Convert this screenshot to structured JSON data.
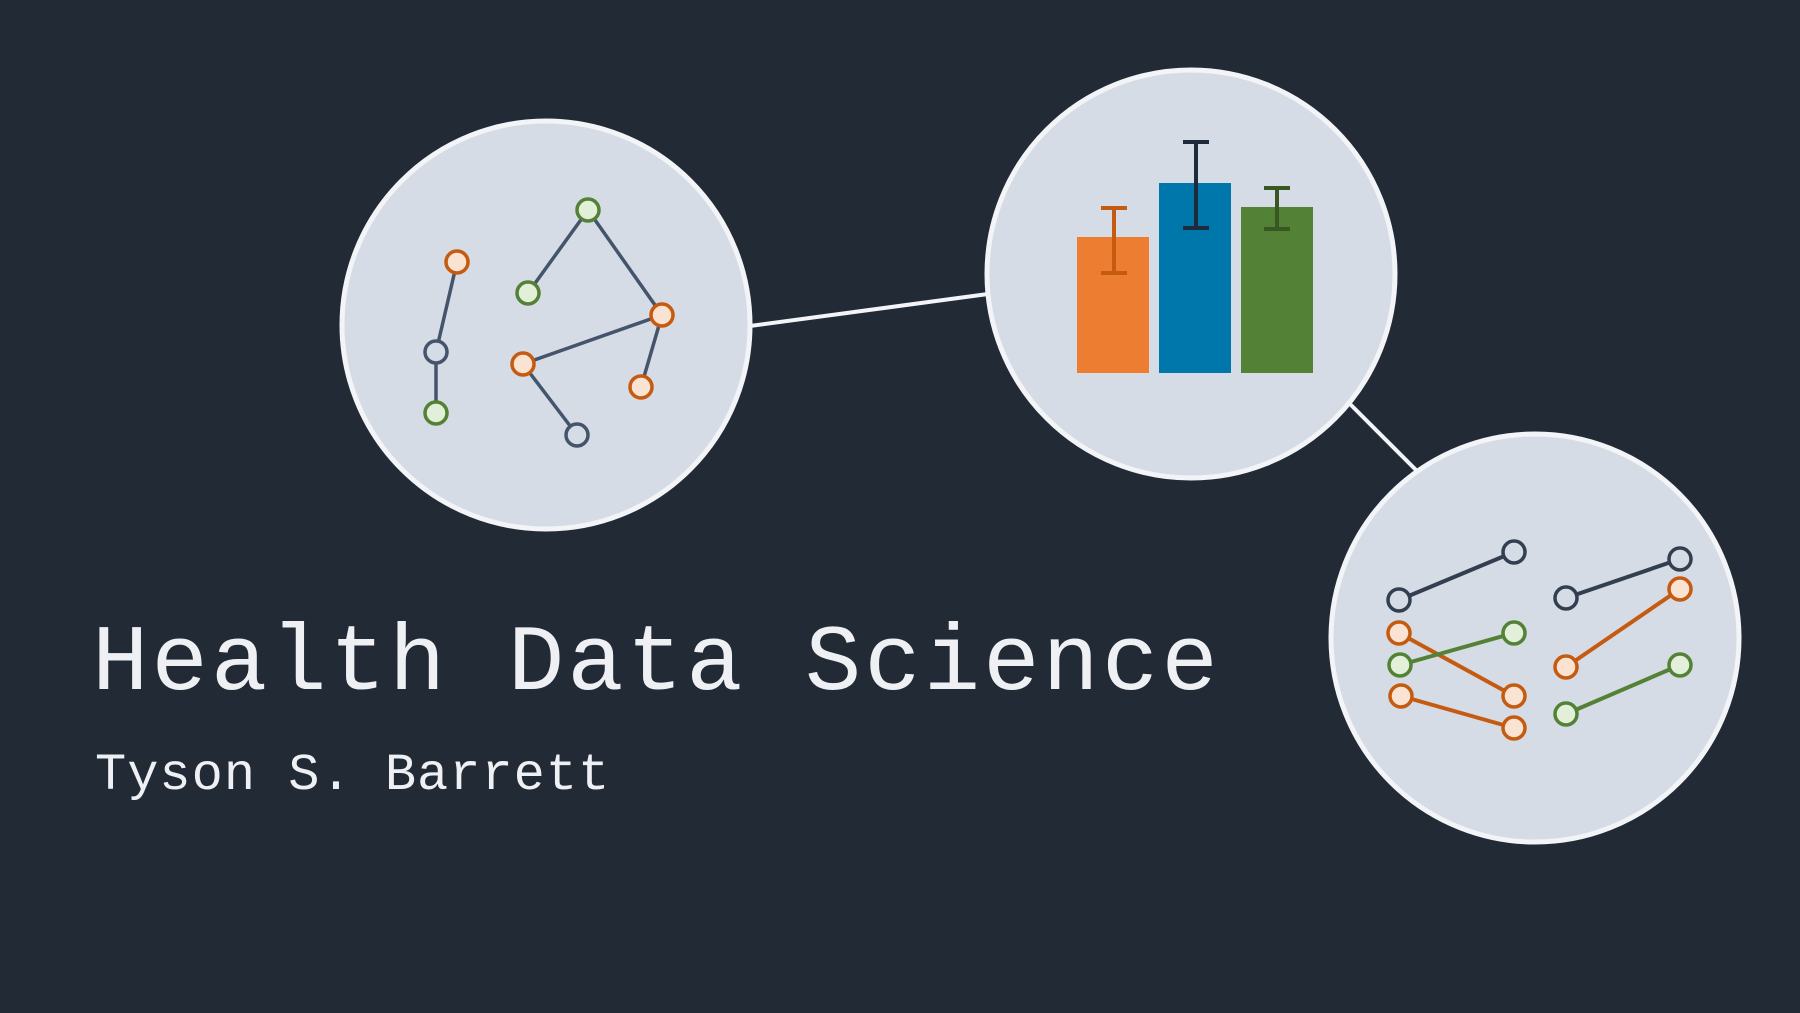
{
  "title": "Health Data Science",
  "author": "Tyson S. Barrett",
  "colors": {
    "background": "#222a35",
    "circle_fill": "#d5dce6",
    "circle_stroke": "#f2f4f7",
    "orange": "#ed7d31",
    "orange_dark": "#c55a11",
    "blue": "#0077aa",
    "green": "#538135",
    "slate": "#44546a",
    "text": "#eef0f4"
  },
  "icons": [
    "network-graph-icon",
    "bar-chart-icon",
    "slope-chart-icon"
  ]
}
